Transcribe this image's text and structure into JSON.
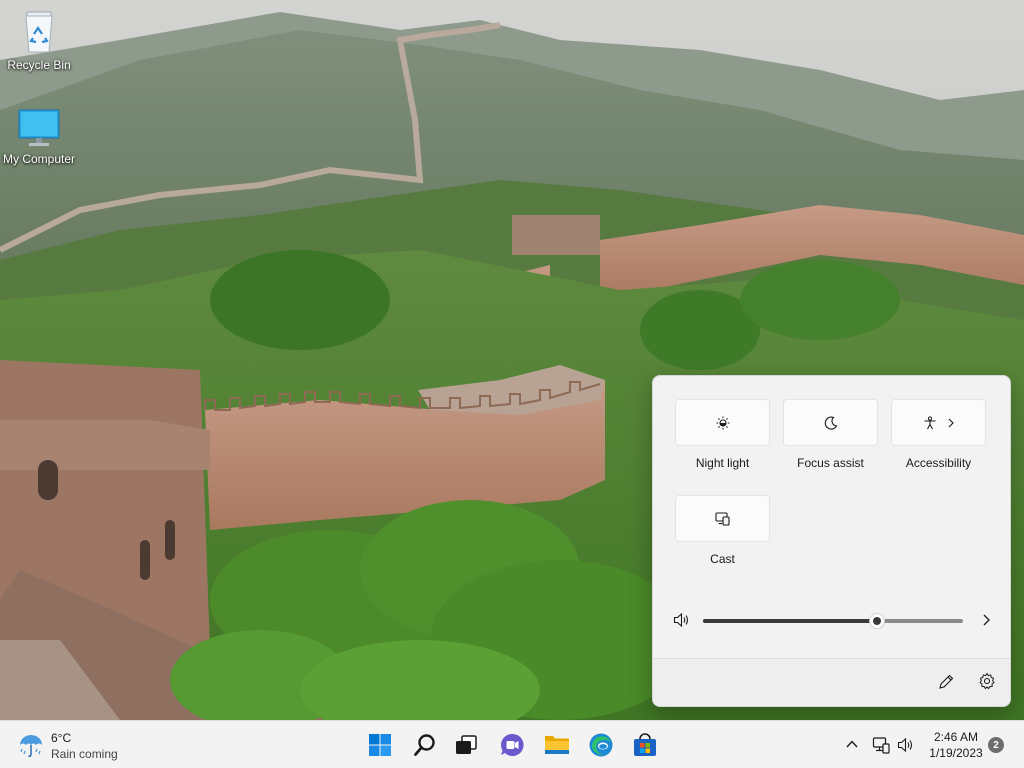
{
  "desktop": {
    "icons": [
      {
        "label": "Recycle Bin"
      },
      {
        "label": "My Computer"
      }
    ]
  },
  "quick_settings": {
    "tiles": [
      {
        "label": "Night light",
        "icon": "brightness-icon",
        "active": false
      },
      {
        "label": "Focus assist",
        "icon": "moon-icon",
        "active": false
      },
      {
        "label": "Accessibility",
        "icon": "accessibility-icon",
        "active": false,
        "has_submenu": true
      },
      {
        "label": "Cast",
        "icon": "cast-icon",
        "active": false
      }
    ],
    "volume": {
      "level_percent": 67
    },
    "footer": {
      "edit_icon": "pencil-icon",
      "settings_icon": "gear-icon"
    }
  },
  "taskbar": {
    "weather": {
      "temperature": "6°C",
      "description": "Rain coming",
      "icon": "umbrella-icon"
    },
    "apps": [
      {
        "name": "start-button",
        "icon": "windows-logo-icon",
        "color": "#0078d4"
      },
      {
        "name": "search-button",
        "icon": "search-icon",
        "color": "#1b1b1b"
      },
      {
        "name": "task-view-button",
        "icon": "task-view-icon",
        "color": "#1b1b1b"
      },
      {
        "name": "chat-button",
        "icon": "chat-icon",
        "color": "#5b5fc7"
      },
      {
        "name": "file-explorer-button",
        "icon": "folder-icon",
        "color": "#f6b93b"
      },
      {
        "name": "edge-button",
        "icon": "edge-icon",
        "color": "#0f7fbf"
      },
      {
        "name": "store-button",
        "icon": "store-icon",
        "color": "#1560bd"
      }
    ],
    "tray": {
      "time": "2:46 AM",
      "date": "1/19/2023",
      "notification_count": "2"
    }
  },
  "colors": {
    "taskbar_bg": "#f3f3f3",
    "flyout_bg": "#f2f2f2",
    "accent": "#0078d4"
  }
}
